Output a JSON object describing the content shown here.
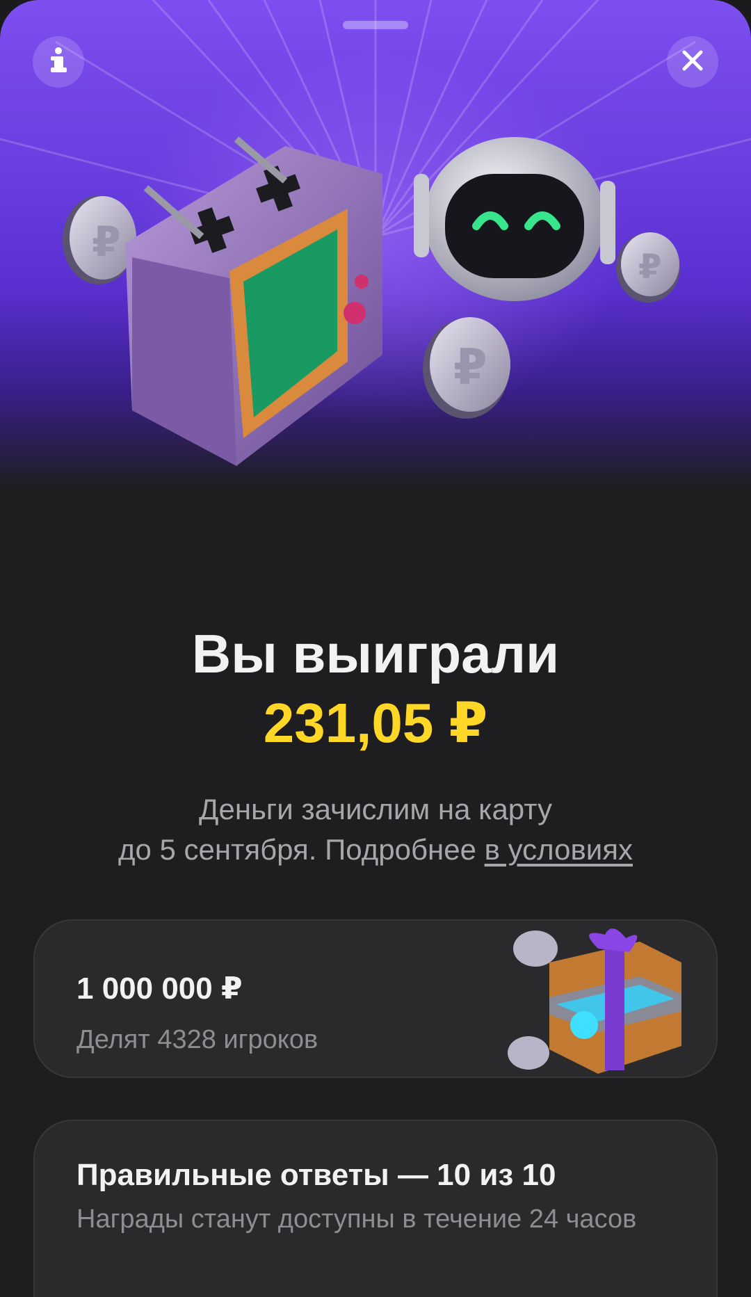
{
  "header": {
    "info_icon": "info-icon",
    "close_icon": "close-icon"
  },
  "result": {
    "title": "Вы выиграли",
    "amount": "231,05 ₽",
    "description_line1": "Деньги зачислим на карту",
    "description_line2": "до 5 сентября. Подробнее ",
    "terms_link": "в условиях"
  },
  "prize_card": {
    "title": "1 000 000 ₽",
    "subtitle": "Делят 4328 игроков"
  },
  "answers_card": {
    "title": "Правильные ответы — 10 из 10",
    "subtitle": "Награды станут доступны в течение 24 часов"
  },
  "colors": {
    "accent_purple": "#7d4ef0",
    "amount_yellow": "#ffd726",
    "background": "#1e1e20",
    "card": "#2a2a2d"
  }
}
